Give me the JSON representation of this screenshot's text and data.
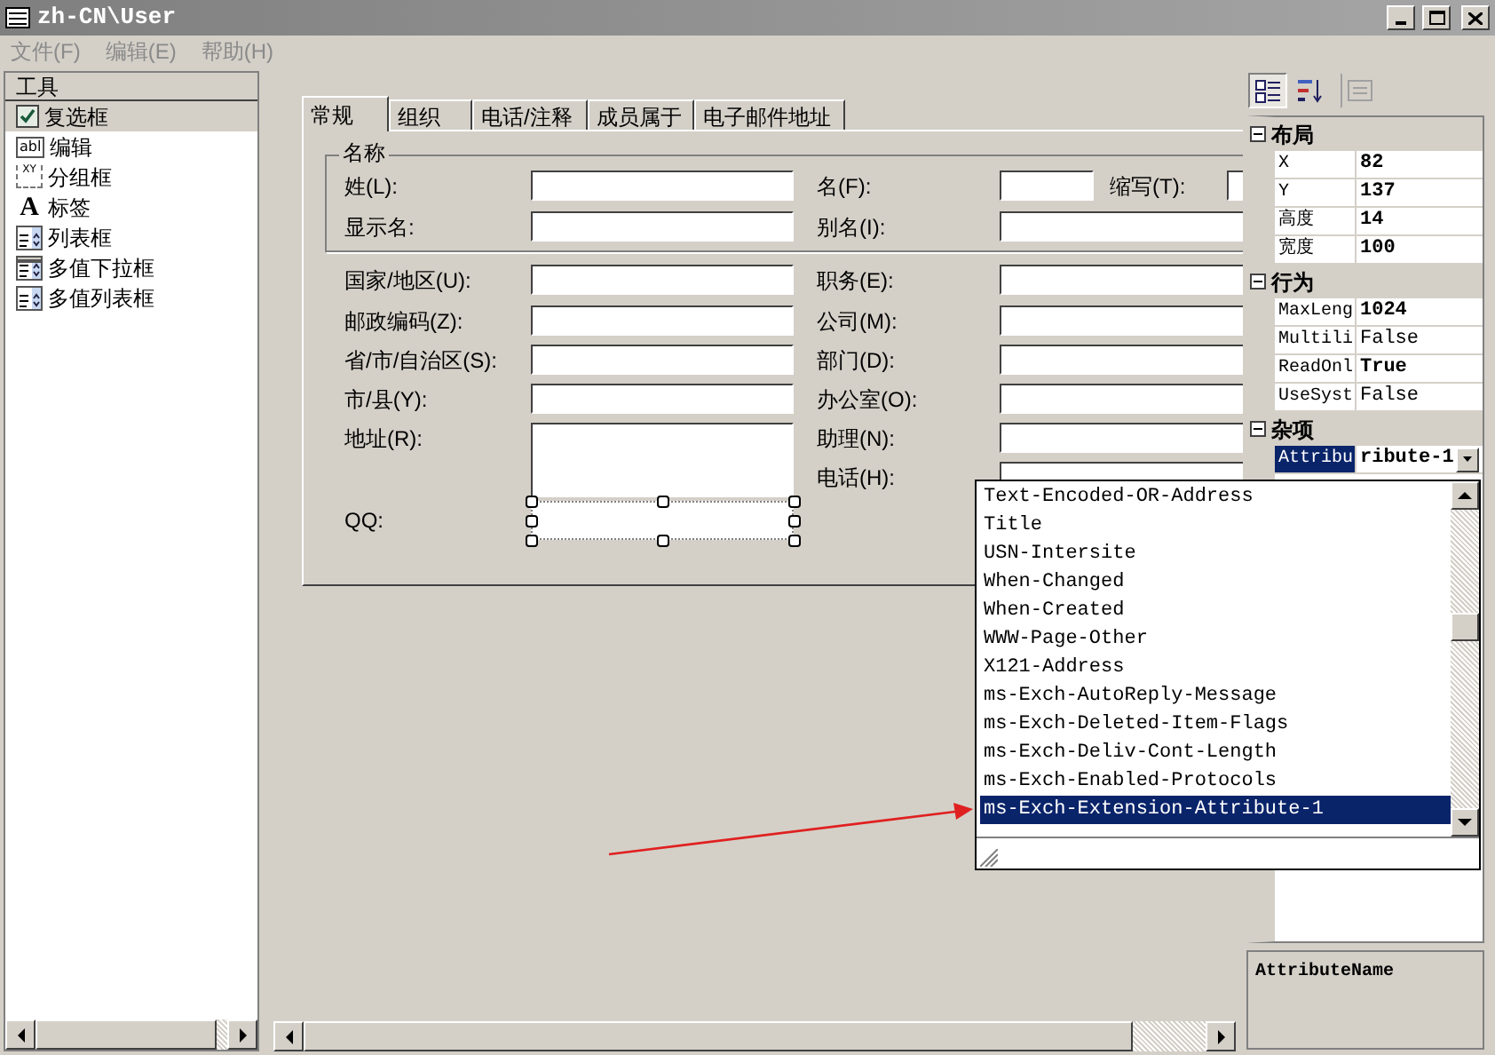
{
  "window": {
    "title": "zh-CN\\User"
  },
  "menu": [
    {
      "label": "文件(F)",
      "disabled": true
    },
    {
      "label": "编辑(E)",
      "disabled": true
    },
    {
      "label": "帮助(H)",
      "disabled": true
    }
  ],
  "toolbox": {
    "title": "工具",
    "items": [
      {
        "label": "复选框",
        "kind": "checkbox",
        "selected": true
      },
      {
        "label": "编辑",
        "kind": "textbox",
        "glyph": "abl",
        "selected": false
      },
      {
        "label": "分组框",
        "kind": "groupbox",
        "glyph": "XY",
        "selected": false
      },
      {
        "label": "标签",
        "kind": "label",
        "glyph": "A",
        "selected": false
      },
      {
        "label": "列表框",
        "kind": "listbox",
        "selected": false
      },
      {
        "label": "多值下拉框",
        "kind": "combobox",
        "selected": false
      },
      {
        "label": "多值列表框",
        "kind": "listbox",
        "selected": false
      }
    ]
  },
  "tabs": [
    {
      "label": "常规",
      "selected": true
    },
    {
      "label": "组织",
      "selected": false
    },
    {
      "label": "电话/注释",
      "selected": false
    },
    {
      "label": "成员属于",
      "selected": false
    },
    {
      "label": "电子邮件地址",
      "selected": false
    }
  ],
  "name_group": {
    "title": "名称",
    "fields": [
      {
        "label": "姓(L):",
        "kind": "text",
        "selected": false
      },
      {
        "label": "名(F):",
        "kind": "text",
        "selected": false
      },
      {
        "label": "缩写(T):",
        "kind": "text",
        "selected": false
      },
      {
        "label": "显示名:",
        "kind": "text",
        "selected": false
      },
      {
        "label": "别名(I):",
        "kind": "text",
        "selected": false
      }
    ]
  },
  "fields": [
    {
      "label": "国家/地区(U):",
      "kind": "text",
      "selected": false
    },
    {
      "label": "职务(E):",
      "kind": "text",
      "selected": false
    },
    {
      "label": "邮政编码(Z):",
      "kind": "text",
      "selected": false
    },
    {
      "label": "公司(M):",
      "kind": "text",
      "selected": false
    },
    {
      "label": "省/市/自治区(S):",
      "kind": "text",
      "selected": false
    },
    {
      "label": "部门(D):",
      "kind": "text",
      "selected": false
    },
    {
      "label": "市/县(Y):",
      "kind": "text",
      "selected": false
    },
    {
      "label": "办公室(O):",
      "kind": "text",
      "selected": false
    },
    {
      "label": "地址(R):",
      "kind": "multiline",
      "selected": false
    },
    {
      "label": "助理(N):",
      "kind": "text",
      "selected": false
    },
    {
      "label": "电话(H):",
      "kind": "text",
      "selected": false
    },
    {
      "label": "QQ:",
      "kind": "text",
      "selected": true
    }
  ],
  "property_toolbar": [
    {
      "kind": "categorized",
      "pressed": true,
      "disabled": false
    },
    {
      "kind": "alphabetical",
      "pressed": false,
      "disabled": false
    },
    {
      "kind": "pages",
      "pressed": false,
      "disabled": true
    }
  ],
  "properties": [
    {
      "category": "布局",
      "expanded": true,
      "items": [
        {
          "name": "X",
          "value": "82",
          "modified": true,
          "selected": false
        },
        {
          "name": "Y",
          "value": "137",
          "modified": true,
          "selected": false
        },
        {
          "name": "高度",
          "value": "14",
          "modified": true,
          "selected": false
        },
        {
          "name": "宽度",
          "value": "100",
          "modified": true,
          "selected": false
        }
      ]
    },
    {
      "category": "行为",
      "expanded": true,
      "items": [
        {
          "name": "MaxLeng",
          "value": "1024",
          "modified": true,
          "selected": false
        },
        {
          "name": "Multili",
          "value": "False",
          "modified": false,
          "selected": false
        },
        {
          "name": "ReadOnl",
          "value": "True",
          "modified": true,
          "selected": false
        },
        {
          "name": "UseSyst",
          "value": "False",
          "modified": false,
          "selected": false
        }
      ]
    },
    {
      "category": "杂项",
      "expanded": true,
      "items": [
        {
          "name": "Attribu",
          "value": "ribute-1",
          "modified": true,
          "selected": true,
          "kind": "dropdown"
        }
      ]
    }
  ],
  "dropdown": {
    "items": [
      {
        "label": "Text-Encoded-OR-Address",
        "selected": false
      },
      {
        "label": "Title",
        "selected": false
      },
      {
        "label": "USN-Intersite",
        "selected": false
      },
      {
        "label": "When-Changed",
        "selected": false
      },
      {
        "label": "When-Created",
        "selected": false
      },
      {
        "label": "WWW-Page-Other",
        "selected": false
      },
      {
        "label": "X121-Address",
        "selected": false
      },
      {
        "label": "ms-Exch-AutoReply-Message",
        "selected": false
      },
      {
        "label": "ms-Exch-Deleted-Item-Flags",
        "selected": false
      },
      {
        "label": "ms-Exch-Deliv-Cont-Length",
        "selected": false
      },
      {
        "label": "ms-Exch-Enabled-Protocols",
        "selected": false
      },
      {
        "label": "ms-Exch-Extension-Attribute-1",
        "selected": true
      }
    ]
  },
  "description": {
    "title": "AttributeName"
  },
  "annotation_arrow": true
}
